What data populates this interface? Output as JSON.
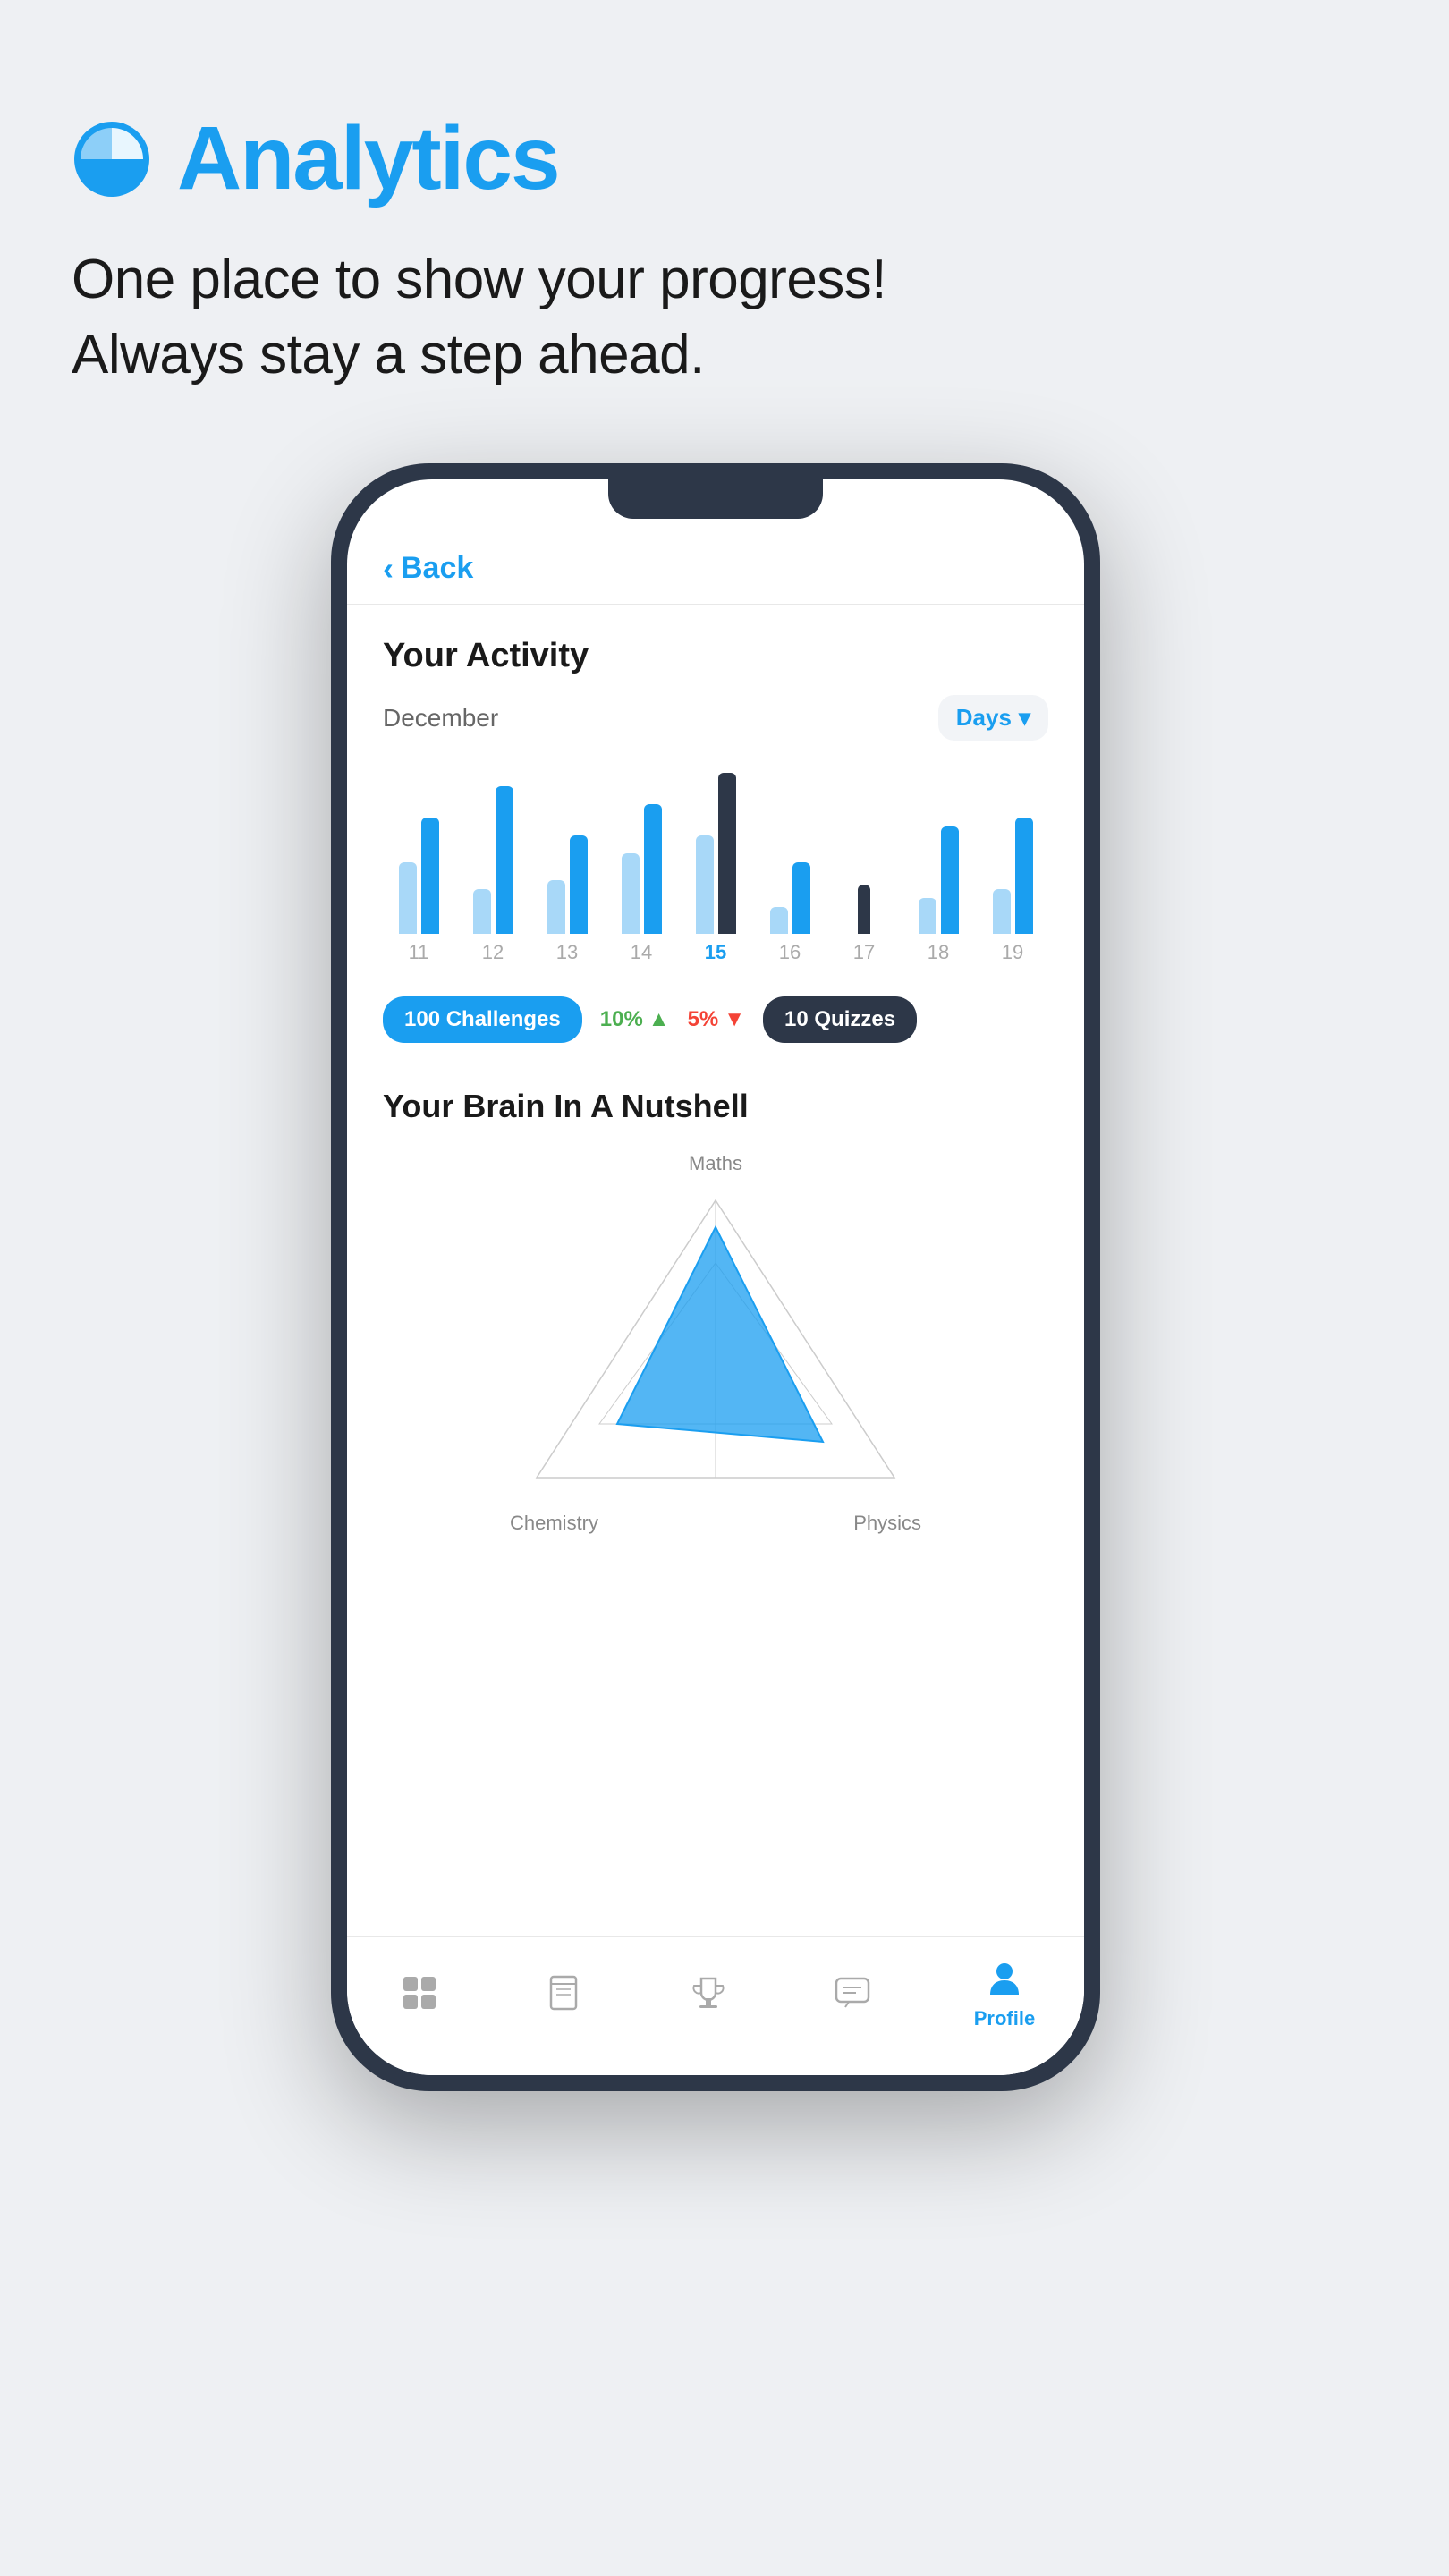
{
  "header": {
    "title": "Analytics",
    "subtitle_line1": "One place to show your progress!",
    "subtitle_line2": "Always stay a step ahead."
  },
  "phone": {
    "back_label": "Back",
    "activity": {
      "section_title": "Your Activity",
      "month": "December",
      "filter": "Days",
      "bars": [
        {
          "day": "11",
          "active": false,
          "heights": [
            80,
            130
          ]
        },
        {
          "day": "12",
          "active": false,
          "heights": [
            50,
            170
          ]
        },
        {
          "day": "13",
          "active": false,
          "heights": [
            60,
            110
          ]
        },
        {
          "day": "14",
          "active": false,
          "heights": [
            90,
            145
          ]
        },
        {
          "day": "15",
          "active": true,
          "heights": [
            110,
            180
          ]
        },
        {
          "day": "16",
          "active": false,
          "heights": [
            30,
            80
          ]
        },
        {
          "day": "17",
          "active": false,
          "heights": [
            0,
            60
          ]
        },
        {
          "day": "18",
          "active": false,
          "heights": [
            40,
            120
          ]
        },
        {
          "day": "19",
          "active": false,
          "heights": [
            50,
            130
          ]
        }
      ],
      "badges": {
        "challenges": "100 Challenges",
        "trend_up": "10%",
        "trend_down": "5%",
        "quizzes": "10 Quizzes"
      }
    },
    "brain": {
      "section_title": "Your Brain In A Nutshell",
      "label_top": "Maths",
      "label_bottom_left": "Chemistry",
      "label_bottom_right": "Physics"
    },
    "nav": {
      "items": [
        {
          "label": "",
          "icon": "grid-icon"
        },
        {
          "label": "",
          "icon": "book-icon"
        },
        {
          "label": "",
          "icon": "trophy-icon"
        },
        {
          "label": "",
          "icon": "chat-icon"
        },
        {
          "label": "Profile",
          "icon": "profile-icon"
        }
      ]
    }
  }
}
